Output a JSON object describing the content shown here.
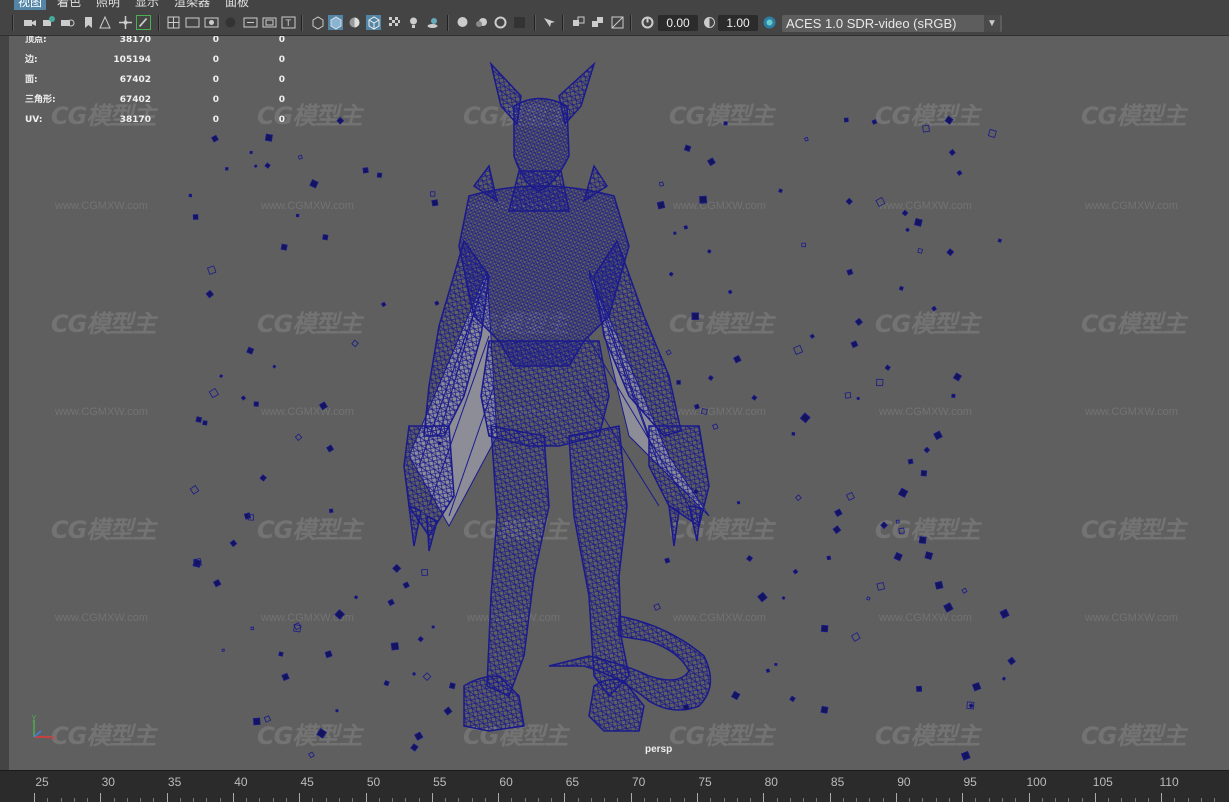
{
  "menu": {
    "items": [
      "视图",
      "着色",
      "照明",
      "显示",
      "渲染器",
      "面板"
    ],
    "active_index": 0
  },
  "toolbar": {
    "field_a": "0.00",
    "field_b": "1.00",
    "color_space": "ACES 1.0 SDR-video (sRGB)"
  },
  "hud": {
    "rows": [
      {
        "label": "顶点:",
        "v1": "38170",
        "v2": "0",
        "v3": "0"
      },
      {
        "label": "边:",
        "v1": "105194",
        "v2": "0",
        "v3": "0"
      },
      {
        "label": "面:",
        "v1": "67402",
        "v2": "0",
        "v3": "0"
      },
      {
        "label": "三角形:",
        "v1": "67402",
        "v2": "0",
        "v3": "0"
      },
      {
        "label": "UV:",
        "v1": "38170",
        "v2": "0",
        "v3": "0"
      }
    ]
  },
  "viewport": {
    "camera_label": "persp",
    "watermark_logo": "CG模型主",
    "watermark_url": "www.CGMXW.com"
  },
  "timeline": {
    "ticks": [
      "25",
      "30",
      "35",
      "40",
      "45",
      "50",
      "55",
      "60",
      "65",
      "70",
      "75",
      "80",
      "85",
      "90",
      "95",
      "100",
      "105",
      "110"
    ]
  },
  "colors": {
    "viewport_bg": "#5f5f5f",
    "wireframe": "#1a1a8c",
    "menu_active": "#5285a6"
  }
}
